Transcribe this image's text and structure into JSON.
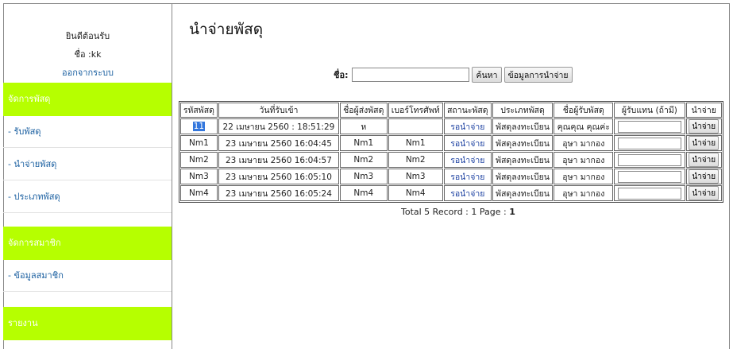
{
  "sidebar": {
    "welcome": "ยินดีต้อนรับ",
    "user": "ชื่อ :kk",
    "logout": "ออกจากระบบ",
    "sections": [
      {
        "title": "จัดการพัสดุ",
        "items": [
          "- รับพัสดุ",
          "- นำจ่ายพัสดุ",
          "- ประเภทพัสดุ"
        ]
      },
      {
        "title": "จัดการสมาชิก",
        "items": [
          "- ข้อมูลสมาชิก"
        ]
      },
      {
        "title": "รายงาน",
        "items": []
      }
    ]
  },
  "page": {
    "title": "นำจ่ายพัสดุ",
    "search_label": "ชื่อ:",
    "search_value": "",
    "search_button": "ค้นหา",
    "info_button": "ข้อมูลการนำจ่าย"
  },
  "table": {
    "headers": [
      "รหัสพัสดุ",
      "วันที่รับเข้า",
      "ชื่อผู้ส่งพัสดุ",
      "เบอร์โทรศัพท์",
      "สถานะพัสดุ",
      "ประเภทพัสดุ",
      "ชื่อผู้รับพัสดุ",
      "ผู้รับแทน (ถ้ามี)",
      "นำจ่าย"
    ],
    "rows": [
      {
        "id": "11",
        "date": "22 เมษายน 2560 : 18:51:29",
        "sender": "ห",
        "phone": "",
        "status": "รอนำจ่าย",
        "type": "พัสดุลงทะเบียน",
        "receiver": "คุณคุณ คุณค่ะ",
        "proxy": "",
        "action": "นำจ่าย"
      },
      {
        "id": "Nm1",
        "date": "23 เมษายน 2560 16:04:45",
        "sender": "Nm1",
        "phone": "Nm1",
        "status": "รอนำจ่าย",
        "type": "พัสดุลงทะเบียน",
        "receiver": "อุษา มากอง",
        "proxy": "",
        "action": "นำจ่าย"
      },
      {
        "id": "Nm2",
        "date": "23 เมษายน 2560 16:04:57",
        "sender": "Nm2",
        "phone": "Nm2",
        "status": "รอนำจ่าย",
        "type": "พัสดุลงทะเบียน",
        "receiver": "อุษา มากอง",
        "proxy": "",
        "action": "นำจ่าย"
      },
      {
        "id": "Nm3",
        "date": "23 เมษายน 2560 16:05:10",
        "sender": "Nm3",
        "phone": "Nm3",
        "status": "รอนำจ่าย",
        "type": "พัสดุลงทะเบียน",
        "receiver": "อุษา มากอง",
        "proxy": "",
        "action": "นำจ่าย"
      },
      {
        "id": "Nm4",
        "date": "23 เมษายน 2560 16:05:24",
        "sender": "Nm4",
        "phone": "Nm4",
        "status": "รอนำจ่าย",
        "type": "พัสดุลงทะเบียน",
        "receiver": "อุษา มากอง",
        "proxy": "",
        "action": "นำจ่าย"
      }
    ]
  },
  "footer": {
    "prefix": "Total 5 Record : 1 Page :",
    "page": "1"
  },
  "colors": {
    "accent": "#b6ff00",
    "link": "#1a5fa0"
  }
}
